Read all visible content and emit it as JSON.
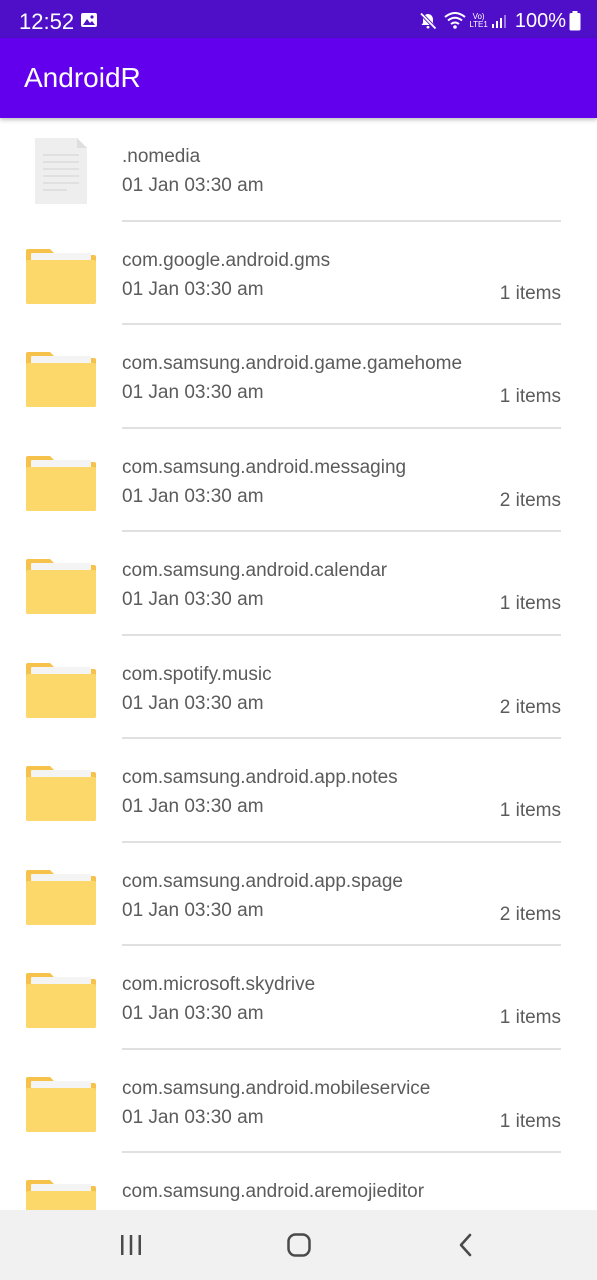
{
  "status_bar": {
    "time": "12:52",
    "network_top": "Vo)",
    "network_bottom": "LTE1",
    "battery": "100%",
    "icons": [
      "gallery-icon",
      "mute-icon",
      "wifi-icon",
      "signal-icon",
      "battery-icon"
    ]
  },
  "app_bar": {
    "title": "AndroidR"
  },
  "files": [
    {
      "name": ".nomedia",
      "date": "01 Jan 03:30 am",
      "count": "",
      "type": "file-icon"
    },
    {
      "name": "com.google.android.gms",
      "date": "01 Jan 03:30 am",
      "count": "1 items",
      "type": "folder-icon"
    },
    {
      "name": "com.samsung.android.game.gamehome",
      "date": "01 Jan 03:30 am",
      "count": "1 items",
      "type": "folder-icon"
    },
    {
      "name": "com.samsung.android.messaging",
      "date": "01 Jan 03:30 am",
      "count": "2 items",
      "type": "folder-icon"
    },
    {
      "name": "com.samsung.android.calendar",
      "date": "01 Jan 03:30 am",
      "count": "1 items",
      "type": "folder-icon"
    },
    {
      "name": "com.spotify.music",
      "date": "01 Jan 03:30 am",
      "count": "2 items",
      "type": "folder-icon"
    },
    {
      "name": "com.samsung.android.app.notes",
      "date": "01 Jan 03:30 am",
      "count": "1 items",
      "type": "folder-icon"
    },
    {
      "name": "com.samsung.android.app.spage",
      "date": "01 Jan 03:30 am",
      "count": "2 items",
      "type": "folder-icon"
    },
    {
      "name": "com.microsoft.skydrive",
      "date": "01 Jan 03:30 am",
      "count": "1 items",
      "type": "folder-icon"
    },
    {
      "name": "com.samsung.android.mobileservice",
      "date": "01 Jan 03:30 am",
      "count": "1 items",
      "type": "folder-icon"
    },
    {
      "name": "com.samsung.android.aremojieditor",
      "date": "",
      "count": "",
      "type": "folder-icon"
    }
  ],
  "nav_bar": {
    "icons": [
      "recent-apps-icon",
      "home-icon",
      "back-icon"
    ]
  },
  "colors": {
    "status_bar": "#4f0fc9",
    "app_bar": "#6200ee",
    "folder": "#fcd86b",
    "text": "#5b5b5b",
    "divider": "#e0e0e0"
  }
}
